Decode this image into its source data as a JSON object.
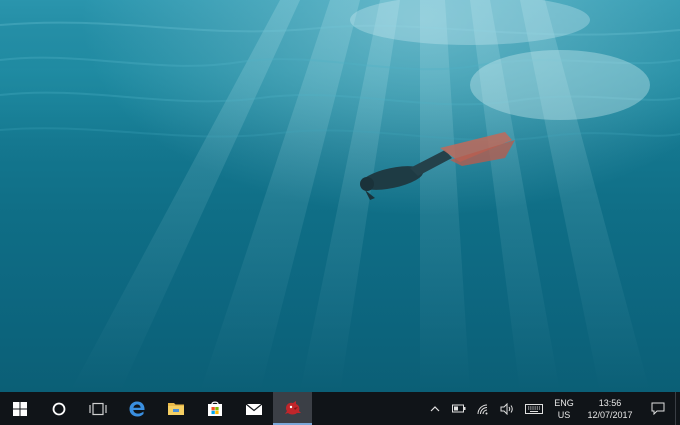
{
  "taskbar": {
    "start_label": "Start",
    "apps": [
      {
        "name": "cortana",
        "icon": "cortana-circle-icon"
      },
      {
        "name": "task-view",
        "icon": "task-view-icon"
      },
      {
        "name": "edge",
        "icon": "edge-icon"
      },
      {
        "name": "file-explorer",
        "icon": "folder-icon"
      },
      {
        "name": "store",
        "icon": "store-bag-icon"
      },
      {
        "name": "mail",
        "icon": "mail-icon"
      },
      {
        "name": "active-app",
        "icon": "red-bird-app-icon",
        "active": true
      }
    ],
    "tray": {
      "language": {
        "line1": "ENG",
        "line2": "US"
      },
      "clock": {
        "time": "13:56",
        "date": "12/07/2017"
      }
    }
  },
  "wallpaper": {
    "description_icon": "underwater-diver-wallpaper"
  },
  "colors": {
    "taskbar_bg": "#101418",
    "active_app_bg": "#3b3f46",
    "accent": "#7aa7d8"
  }
}
